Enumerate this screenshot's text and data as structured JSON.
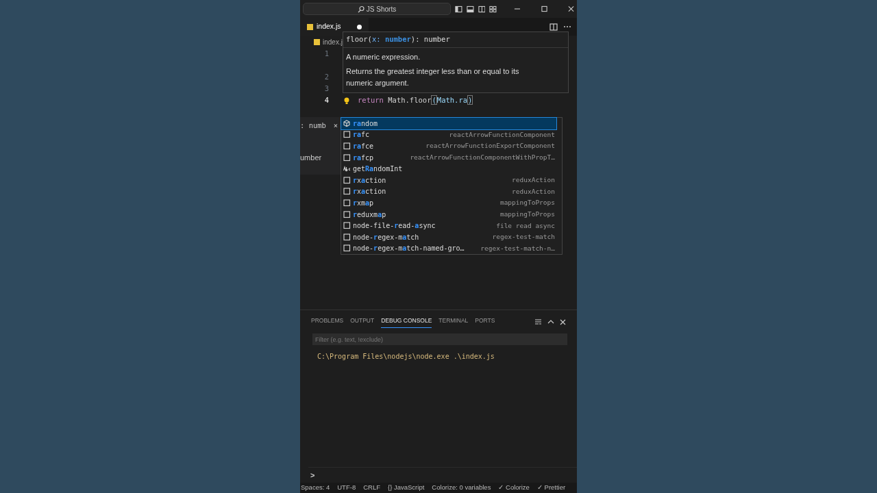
{
  "title_bar": {
    "search": "JS Shorts"
  },
  "tabs": [
    {
      "label": "index.js",
      "modified": true,
      "selected": true
    }
  ],
  "breadcrumb": "index.j",
  "lines": [
    {
      "number": "1"
    },
    {
      "number": "2"
    },
    {
      "number": "3"
    },
    {
      "number": "4",
      "current": true,
      "code": [
        {
          "text": "return",
          "kind": "keyword"
        },
        {
          "text": " Math.floor",
          "kind": "plain"
        },
        {
          "text": "(",
          "kind": "bracket"
        },
        {
          "text": "Math.ra",
          "kind": "ident"
        },
        {
          "text": ")",
          "kind": "bracket"
        }
      ]
    }
  ],
  "side_fragment": {
    "first": ": numb",
    "close": "×",
    "second": "umber"
  },
  "hover": {
    "signature": [
      {
        "text": "floor(",
        "kind": "plain"
      },
      {
        "text": "x: ",
        "kind": "param"
      },
      {
        "text": "number",
        "kind": "type"
      },
      {
        "text": "): number",
        "kind": "plain"
      }
    ],
    "paragraphs": [
      "A numeric expression.",
      "Returns the greatest integer less than or equal to its numeric argument."
    ]
  },
  "suggestions": [
    {
      "kind": "method",
      "selected": true,
      "label": [
        {
          "text": "ra",
          "match": true
        },
        {
          "text": "ndom",
          "match": false
        }
      ]
    },
    {
      "kind": "snippet",
      "selected": false,
      "label": [
        {
          "text": "ra",
          "match": true
        },
        {
          "text": "fc",
          "match": false
        }
      ],
      "detail": "reactArrowFunctionComponent"
    },
    {
      "kind": "snippet",
      "selected": false,
      "label": [
        {
          "text": "ra",
          "match": true
        },
        {
          "text": "fce",
          "match": false
        }
      ],
      "detail": "reactArrowFunctionExportComponent"
    },
    {
      "kind": "snippet",
      "selected": false,
      "label": [
        {
          "text": "ra",
          "match": true
        },
        {
          "text": "fcp",
          "match": false
        }
      ],
      "detail": "reactArrowFunctionComponentWithPropT…"
    },
    {
      "kind": "text",
      "selected": false,
      "label": [
        {
          "text": "get",
          "match": false
        },
        {
          "text": "Ra",
          "match": true
        },
        {
          "text": "ndomInt",
          "match": false
        }
      ]
    },
    {
      "kind": "snippet",
      "selected": false,
      "label": [
        {
          "text": "r",
          "match": true
        },
        {
          "text": "x",
          "match": false
        },
        {
          "text": "a",
          "match": true
        },
        {
          "text": "ction",
          "match": false
        }
      ],
      "detail": "reduxAction"
    },
    {
      "kind": "snippet",
      "selected": false,
      "label": [
        {
          "text": "r",
          "match": true
        },
        {
          "text": "x",
          "match": false
        },
        {
          "text": "a",
          "match": true
        },
        {
          "text": "ction",
          "match": false
        }
      ],
      "detail": "reduxAction"
    },
    {
      "kind": "snippet",
      "selected": false,
      "label": [
        {
          "text": "r",
          "match": true
        },
        {
          "text": "xm",
          "match": false
        },
        {
          "text": "a",
          "match": true
        },
        {
          "text": "p",
          "match": false
        }
      ],
      "detail": "mappingToProps"
    },
    {
      "kind": "snippet",
      "selected": false,
      "label": [
        {
          "text": "r",
          "match": true
        },
        {
          "text": "eduxm",
          "match": false
        },
        {
          "text": "a",
          "match": true
        },
        {
          "text": "p",
          "match": false
        }
      ],
      "detail": "mappingToProps"
    },
    {
      "kind": "snippet",
      "selected": false,
      "label": [
        {
          "text": "node-file-",
          "match": false
        },
        {
          "text": "r",
          "match": true
        },
        {
          "text": "ead-",
          "match": false
        },
        {
          "text": "a",
          "match": true
        },
        {
          "text": "sync",
          "match": false
        }
      ],
      "detail": "file read async"
    },
    {
      "kind": "snippet",
      "selected": false,
      "label": [
        {
          "text": "node-",
          "match": false
        },
        {
          "text": "r",
          "match": true
        },
        {
          "text": "egex-m",
          "match": false
        },
        {
          "text": "a",
          "match": true
        },
        {
          "text": "tch",
          "match": false
        }
      ],
      "detail": "regex-test-match"
    },
    {
      "kind": "snippet",
      "selected": false,
      "label": [
        {
          "text": "node-",
          "match": false
        },
        {
          "text": "r",
          "match": true
        },
        {
          "text": "egex-m",
          "match": false
        },
        {
          "text": "a",
          "match": true
        },
        {
          "text": "tch-named-gro…",
          "match": false
        }
      ],
      "detail": "regex-test-match-n…"
    }
  ],
  "panel": {
    "tabs": [
      {
        "label": "PROBLEMS",
        "selected": false
      },
      {
        "label": "OUTPUT",
        "selected": false
      },
      {
        "label": "DEBUG CONSOLE",
        "selected": true
      },
      {
        "label": "TERMINAL",
        "selected": false
      },
      {
        "label": "PORTS",
        "selected": false
      }
    ],
    "filter": {
      "placeholder": "Filter (e.g. text, !exclude)"
    },
    "output": [
      "C:\\Program Files\\nodejs\\node.exe .\\index.js"
    ],
    "prompt": ">"
  },
  "status_bar": [
    "Spaces: 4",
    "UTF-8",
    "CRLF",
    "{} JavaScript",
    "Colorize: 0 variables",
    "✓ Colorize",
    "✓ Prettier"
  ]
}
